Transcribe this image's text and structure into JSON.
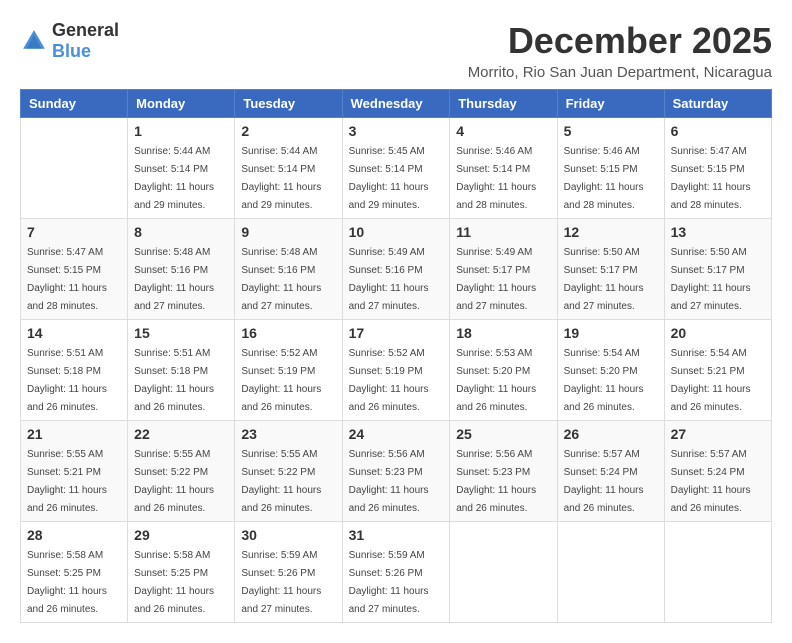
{
  "header": {
    "logo_general": "General",
    "logo_blue": "Blue",
    "month_title": "December 2025",
    "location": "Morrito, Rio San Juan Department, Nicaragua"
  },
  "calendar": {
    "days_of_week": [
      "Sunday",
      "Monday",
      "Tuesday",
      "Wednesday",
      "Thursday",
      "Friday",
      "Saturday"
    ],
    "weeks": [
      [
        {
          "day": "",
          "sunrise": "",
          "sunset": "",
          "daylight": ""
        },
        {
          "day": "1",
          "sunrise": "Sunrise: 5:44 AM",
          "sunset": "Sunset: 5:14 PM",
          "daylight": "Daylight: 11 hours and 29 minutes."
        },
        {
          "day": "2",
          "sunrise": "Sunrise: 5:44 AM",
          "sunset": "Sunset: 5:14 PM",
          "daylight": "Daylight: 11 hours and 29 minutes."
        },
        {
          "day": "3",
          "sunrise": "Sunrise: 5:45 AM",
          "sunset": "Sunset: 5:14 PM",
          "daylight": "Daylight: 11 hours and 29 minutes."
        },
        {
          "day": "4",
          "sunrise": "Sunrise: 5:46 AM",
          "sunset": "Sunset: 5:14 PM",
          "daylight": "Daylight: 11 hours and 28 minutes."
        },
        {
          "day": "5",
          "sunrise": "Sunrise: 5:46 AM",
          "sunset": "Sunset: 5:15 PM",
          "daylight": "Daylight: 11 hours and 28 minutes."
        },
        {
          "day": "6",
          "sunrise": "Sunrise: 5:47 AM",
          "sunset": "Sunset: 5:15 PM",
          "daylight": "Daylight: 11 hours and 28 minutes."
        }
      ],
      [
        {
          "day": "7",
          "sunrise": "Sunrise: 5:47 AM",
          "sunset": "Sunset: 5:15 PM",
          "daylight": "Daylight: 11 hours and 28 minutes."
        },
        {
          "day": "8",
          "sunrise": "Sunrise: 5:48 AM",
          "sunset": "Sunset: 5:16 PM",
          "daylight": "Daylight: 11 hours and 27 minutes."
        },
        {
          "day": "9",
          "sunrise": "Sunrise: 5:48 AM",
          "sunset": "Sunset: 5:16 PM",
          "daylight": "Daylight: 11 hours and 27 minutes."
        },
        {
          "day": "10",
          "sunrise": "Sunrise: 5:49 AM",
          "sunset": "Sunset: 5:16 PM",
          "daylight": "Daylight: 11 hours and 27 minutes."
        },
        {
          "day": "11",
          "sunrise": "Sunrise: 5:49 AM",
          "sunset": "Sunset: 5:17 PM",
          "daylight": "Daylight: 11 hours and 27 minutes."
        },
        {
          "day": "12",
          "sunrise": "Sunrise: 5:50 AM",
          "sunset": "Sunset: 5:17 PM",
          "daylight": "Daylight: 11 hours and 27 minutes."
        },
        {
          "day": "13",
          "sunrise": "Sunrise: 5:50 AM",
          "sunset": "Sunset: 5:17 PM",
          "daylight": "Daylight: 11 hours and 27 minutes."
        }
      ],
      [
        {
          "day": "14",
          "sunrise": "Sunrise: 5:51 AM",
          "sunset": "Sunset: 5:18 PM",
          "daylight": "Daylight: 11 hours and 26 minutes."
        },
        {
          "day": "15",
          "sunrise": "Sunrise: 5:51 AM",
          "sunset": "Sunset: 5:18 PM",
          "daylight": "Daylight: 11 hours and 26 minutes."
        },
        {
          "day": "16",
          "sunrise": "Sunrise: 5:52 AM",
          "sunset": "Sunset: 5:19 PM",
          "daylight": "Daylight: 11 hours and 26 minutes."
        },
        {
          "day": "17",
          "sunrise": "Sunrise: 5:52 AM",
          "sunset": "Sunset: 5:19 PM",
          "daylight": "Daylight: 11 hours and 26 minutes."
        },
        {
          "day": "18",
          "sunrise": "Sunrise: 5:53 AM",
          "sunset": "Sunset: 5:20 PM",
          "daylight": "Daylight: 11 hours and 26 minutes."
        },
        {
          "day": "19",
          "sunrise": "Sunrise: 5:54 AM",
          "sunset": "Sunset: 5:20 PM",
          "daylight": "Daylight: 11 hours and 26 minutes."
        },
        {
          "day": "20",
          "sunrise": "Sunrise: 5:54 AM",
          "sunset": "Sunset: 5:21 PM",
          "daylight": "Daylight: 11 hours and 26 minutes."
        }
      ],
      [
        {
          "day": "21",
          "sunrise": "Sunrise: 5:55 AM",
          "sunset": "Sunset: 5:21 PM",
          "daylight": "Daylight: 11 hours and 26 minutes."
        },
        {
          "day": "22",
          "sunrise": "Sunrise: 5:55 AM",
          "sunset": "Sunset: 5:22 PM",
          "daylight": "Daylight: 11 hours and 26 minutes."
        },
        {
          "day": "23",
          "sunrise": "Sunrise: 5:55 AM",
          "sunset": "Sunset: 5:22 PM",
          "daylight": "Daylight: 11 hours and 26 minutes."
        },
        {
          "day": "24",
          "sunrise": "Sunrise: 5:56 AM",
          "sunset": "Sunset: 5:23 PM",
          "daylight": "Daylight: 11 hours and 26 minutes."
        },
        {
          "day": "25",
          "sunrise": "Sunrise: 5:56 AM",
          "sunset": "Sunset: 5:23 PM",
          "daylight": "Daylight: 11 hours and 26 minutes."
        },
        {
          "day": "26",
          "sunrise": "Sunrise: 5:57 AM",
          "sunset": "Sunset: 5:24 PM",
          "daylight": "Daylight: 11 hours and 26 minutes."
        },
        {
          "day": "27",
          "sunrise": "Sunrise: 5:57 AM",
          "sunset": "Sunset: 5:24 PM",
          "daylight": "Daylight: 11 hours and 26 minutes."
        }
      ],
      [
        {
          "day": "28",
          "sunrise": "Sunrise: 5:58 AM",
          "sunset": "Sunset: 5:25 PM",
          "daylight": "Daylight: 11 hours and 26 minutes."
        },
        {
          "day": "29",
          "sunrise": "Sunrise: 5:58 AM",
          "sunset": "Sunset: 5:25 PM",
          "daylight": "Daylight: 11 hours and 26 minutes."
        },
        {
          "day": "30",
          "sunrise": "Sunrise: 5:59 AM",
          "sunset": "Sunset: 5:26 PM",
          "daylight": "Daylight: 11 hours and 27 minutes."
        },
        {
          "day": "31",
          "sunrise": "Sunrise: 5:59 AM",
          "sunset": "Sunset: 5:26 PM",
          "daylight": "Daylight: 11 hours and 27 minutes."
        },
        {
          "day": "",
          "sunrise": "",
          "sunset": "",
          "daylight": ""
        },
        {
          "day": "",
          "sunrise": "",
          "sunset": "",
          "daylight": ""
        },
        {
          "day": "",
          "sunrise": "",
          "sunset": "",
          "daylight": ""
        }
      ]
    ]
  }
}
